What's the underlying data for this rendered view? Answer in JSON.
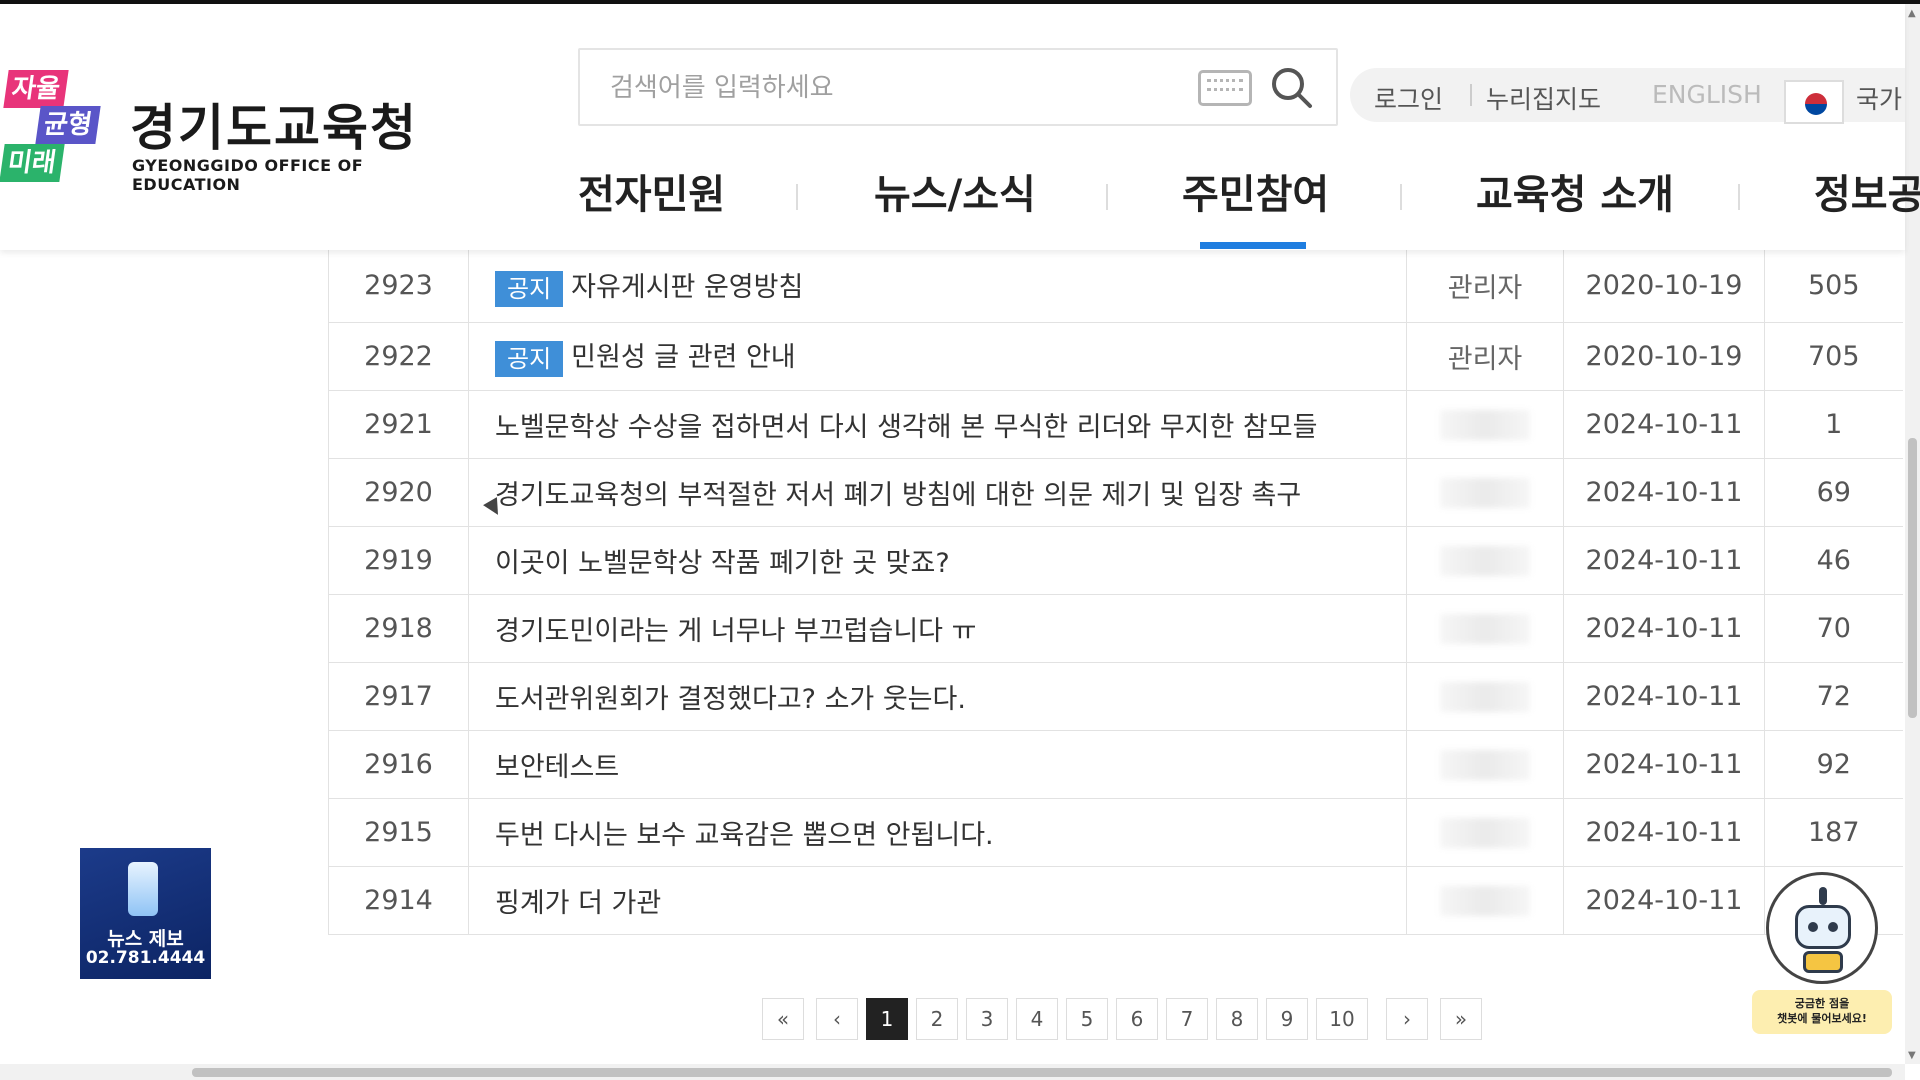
{
  "logo": {
    "badge1": "자율",
    "badge2": "균형",
    "badge3": "미래",
    "title": "경기도교육청",
    "subtitle": "GYEONGGIDO OFFICE OF EDUCATION"
  },
  "search": {
    "placeholder": "검색어를 입력하세요",
    "keyboard_icon": "keyboard-icon",
    "search_icon": "search-icon"
  },
  "util": {
    "login": "로그인",
    "map": "누리집지도",
    "english": "ENGLISH",
    "national": "국가"
  },
  "gnb": {
    "items": [
      "전자민원",
      "뉴스/소식",
      "주민참여",
      "교육청 소개",
      "정보공"
    ],
    "active_index": 2
  },
  "board": {
    "rows": [
      {
        "no": "2923",
        "notice": "공지",
        "title": "자유게시판 운영방침",
        "writer": "관리자",
        "date": "2020-10-19",
        "views": "505"
      },
      {
        "no": "2922",
        "notice": "공지",
        "title": "민원성 글 관련 안내",
        "writer": "관리자",
        "date": "2020-10-19",
        "views": "705"
      },
      {
        "no": "2921",
        "notice": "",
        "title": "노벨문학상 수상을 접하면서 다시 생각해 본 무식한 리더와 무지한 참모들",
        "writer": "",
        "date": "2024-10-11",
        "views": "1"
      },
      {
        "no": "2920",
        "notice": "",
        "title": "경기도교육청의 부적절한 저서 폐기 방침에 대한 의문 제기 및 입장 촉구",
        "writer": "",
        "date": "2024-10-11",
        "views": "69"
      },
      {
        "no": "2919",
        "notice": "",
        "title": "이곳이 노벨문학상 작품 폐기한 곳 맞죠?",
        "writer": "",
        "date": "2024-10-11",
        "views": "46"
      },
      {
        "no": "2918",
        "notice": "",
        "title": "경기도민이라는 게 너무나 부끄럽습니다 ㅠ",
        "writer": "",
        "date": "2024-10-11",
        "views": "70"
      },
      {
        "no": "2917",
        "notice": "",
        "title": "도서관위원회가 결정했다고? 소가 웃는다.",
        "writer": "",
        "date": "2024-10-11",
        "views": "72"
      },
      {
        "no": "2916",
        "notice": "",
        "title": "보안테스트",
        "writer": "",
        "date": "2024-10-11",
        "views": "92"
      },
      {
        "no": "2915",
        "notice": "",
        "title": "두번 다시는 보수 교육감은 뽑으면 안됩니다.",
        "writer": "",
        "date": "2024-10-11",
        "views": "187"
      },
      {
        "no": "2914",
        "notice": "",
        "title": "핑계가 더 가관",
        "writer": "",
        "date": "2024-10-11",
        "views": ""
      }
    ]
  },
  "pagination": {
    "first": "«",
    "prev": "‹",
    "pages": [
      "1",
      "2",
      "3",
      "4",
      "5",
      "6",
      "7",
      "8",
      "9",
      "10"
    ],
    "current": "1",
    "next": "›",
    "last": "»"
  },
  "news_tip": {
    "label": "뉴스 제보",
    "tel": "02.781.4444"
  },
  "chatbot": {
    "line1": "궁금한 점을",
    "line2": "챗봇에 물어보세요!"
  },
  "colors": {
    "accent": "#1f7ee0",
    "notice_tag": "#3f8fd8",
    "news_banner": "#1c3b8a"
  }
}
